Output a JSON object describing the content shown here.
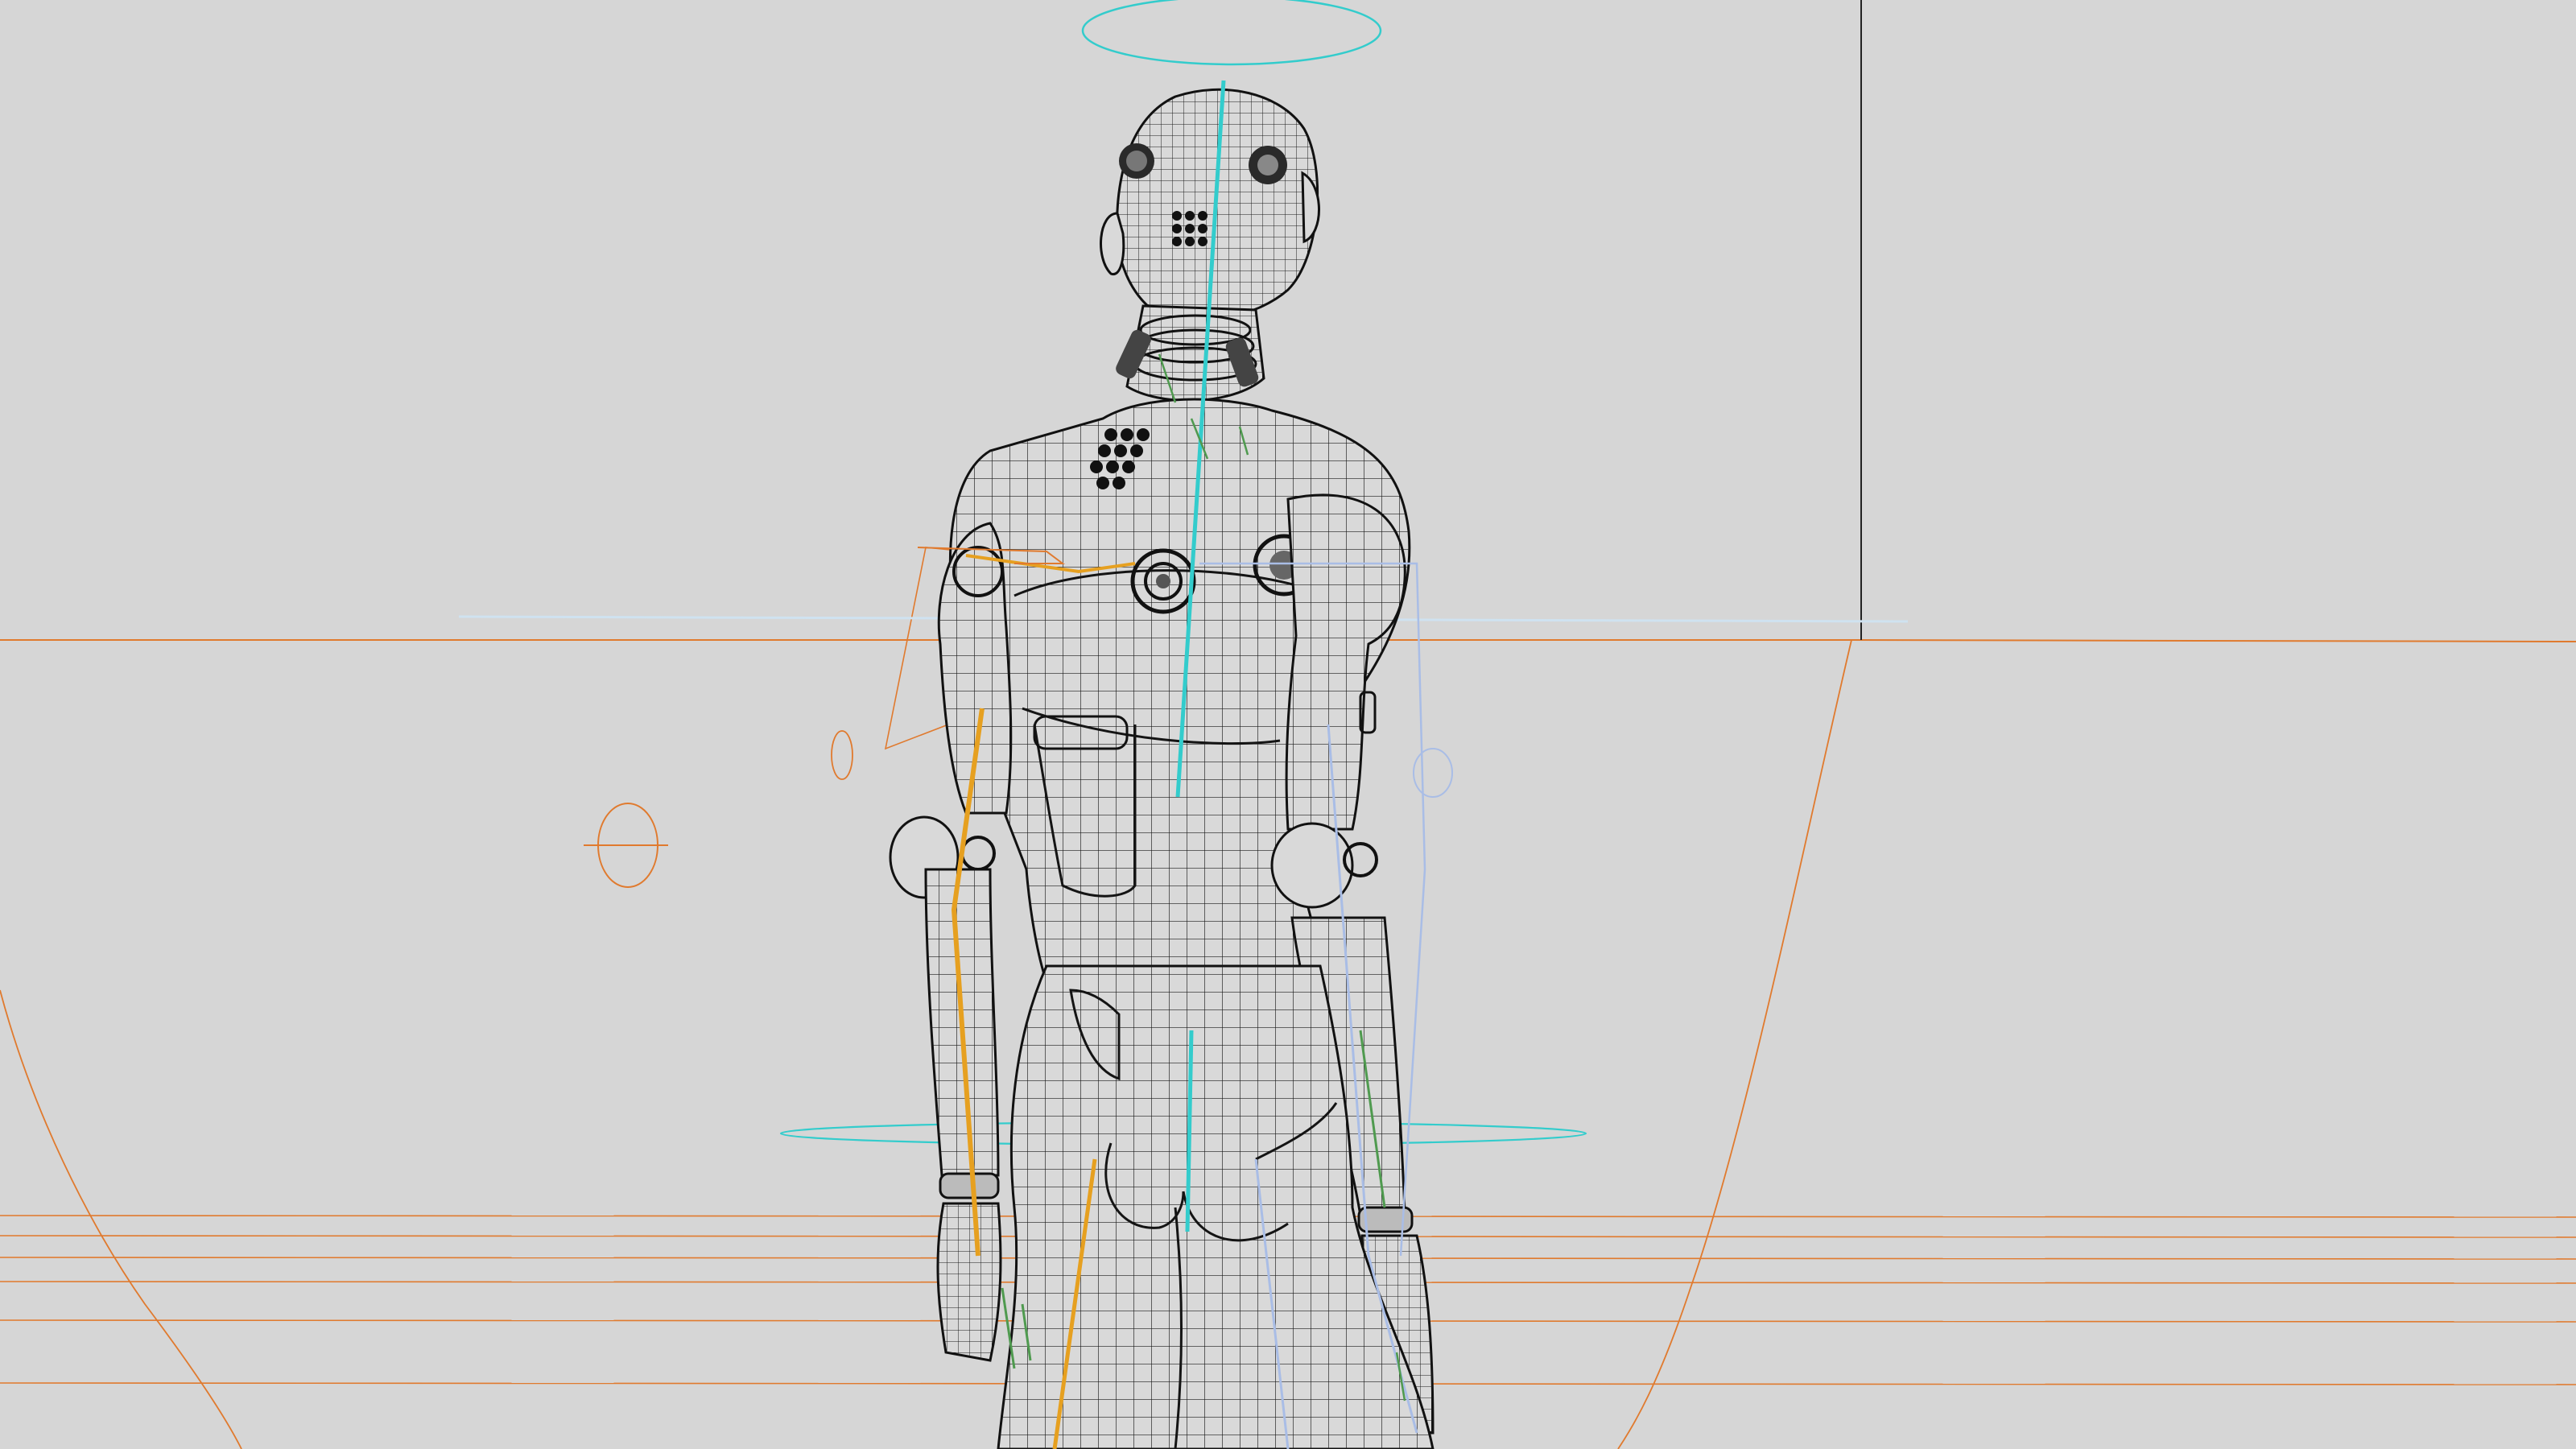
{
  "viewport": {
    "mode": "wireframe",
    "background_color": "#d6d6d6",
    "subject": "robot-mannequin"
  },
  "colors": {
    "mesh": "#141414",
    "guide_orange": "#e07a2e",
    "bone_cyan": "#33cccc",
    "control_pale_blue": "#a9bde6",
    "constraint_green": "#4f9a4f",
    "gold_bone": "#e6a020"
  }
}
